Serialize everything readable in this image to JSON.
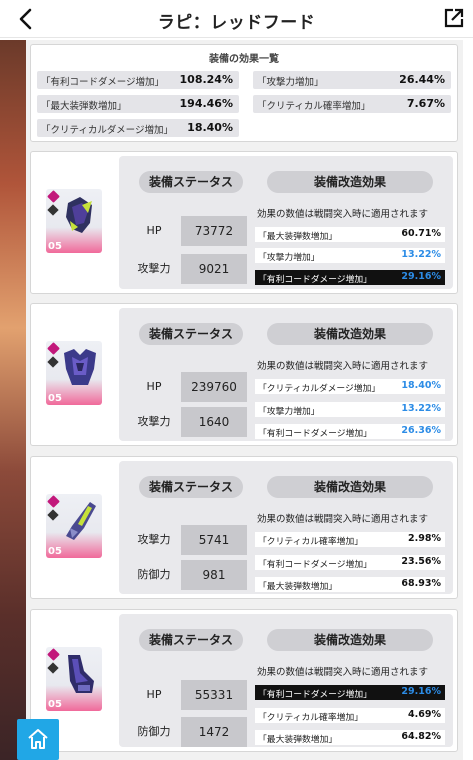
{
  "header": {
    "title": "ラピ：レッドフード"
  },
  "summary": {
    "title": "装備の効果一覧",
    "items": [
      {
        "label": "「有利コードダメージ増加」",
        "value": "108.24%"
      },
      {
        "label": "「攻撃力増加」",
        "value": "26.44%"
      },
      {
        "label": "「最大装弾数増加」",
        "value": "194.46%"
      },
      {
        "label": "「クリティカル確率増加」",
        "value": "7.67%"
      },
      {
        "label": "「クリティカルダメージ増加」",
        "value": "18.40%"
      }
    ]
  },
  "equipment": [
    {
      "level": "05",
      "status_title": "装備ステータス",
      "effect_title": "装備改造効果",
      "note": "効果の数値は戦闘突入時に適用されます",
      "stats": [
        {
          "label": "HP",
          "value": "73772"
        },
        {
          "label": "攻撃力",
          "value": "9021"
        }
      ],
      "effects": [
        {
          "label": "「最大装弾数増加」",
          "value": "60.71%",
          "highlight": false,
          "color": "black"
        },
        {
          "label": "「攻撃力増加」",
          "value": "13.22%",
          "highlight": false,
          "color": "blue"
        },
        {
          "label": "「有利コードダメージ増加」",
          "value": "29.16%",
          "highlight": true,
          "color": "blue"
        }
      ]
    },
    {
      "level": "05",
      "status_title": "装備ステータス",
      "effect_title": "装備改造効果",
      "note": "効果の数値は戦闘突入時に適用されます",
      "stats": [
        {
          "label": "HP",
          "value": "239760"
        },
        {
          "label": "攻撃力",
          "value": "1640"
        }
      ],
      "effects": [
        {
          "label": "「クリティカルダメージ増加」",
          "value": "18.40%",
          "highlight": false,
          "color": "blue"
        },
        {
          "label": "「攻撃力増加」",
          "value": "13.22%",
          "highlight": false,
          "color": "blue"
        },
        {
          "label": "「有利コードダメージ増加」",
          "value": "26.36%",
          "highlight": false,
          "color": "blue"
        }
      ]
    },
    {
      "level": "05",
      "status_title": "装備ステータス",
      "effect_title": "装備改造効果",
      "note": "効果の数値は戦闘突入時に適用されます",
      "stats": [
        {
          "label": "攻撃力",
          "value": "5741"
        },
        {
          "label": "防御力",
          "value": "981"
        }
      ],
      "effects": [
        {
          "label": "「クリティカル確率増加」",
          "value": "2.98%",
          "highlight": false,
          "color": "black"
        },
        {
          "label": "「有利コードダメージ増加」",
          "value": "23.56%",
          "highlight": false,
          "color": "black"
        },
        {
          "label": "「最大装弾数増加」",
          "value": "68.93%",
          "highlight": false,
          "color": "black"
        }
      ]
    },
    {
      "level": "05",
      "status_title": "装備ステータス",
      "effect_title": "装備改造効果",
      "note": "効果の数値は戦闘突入時に適用されます",
      "stats": [
        {
          "label": "HP",
          "value": "55331"
        },
        {
          "label": "防御力",
          "value": "1472"
        }
      ],
      "effects": [
        {
          "label": "「有利コードダメージ増加」",
          "value": "29.16%",
          "highlight": true,
          "color": "blue"
        },
        {
          "label": "「クリティカル確率増加」",
          "value": "4.69%",
          "highlight": false,
          "color": "black"
        },
        {
          "label": "「最大装弾数増加」",
          "value": "64.82%",
          "highlight": false,
          "color": "black"
        }
      ]
    }
  ],
  "colors": {
    "accent_blue": "#2c8ce6",
    "home_button": "#21a7e6",
    "rarity": "#c2187b"
  },
  "icons": {
    "back": "chevron-left-icon",
    "share": "external-link-icon",
    "home": "home-icon"
  }
}
